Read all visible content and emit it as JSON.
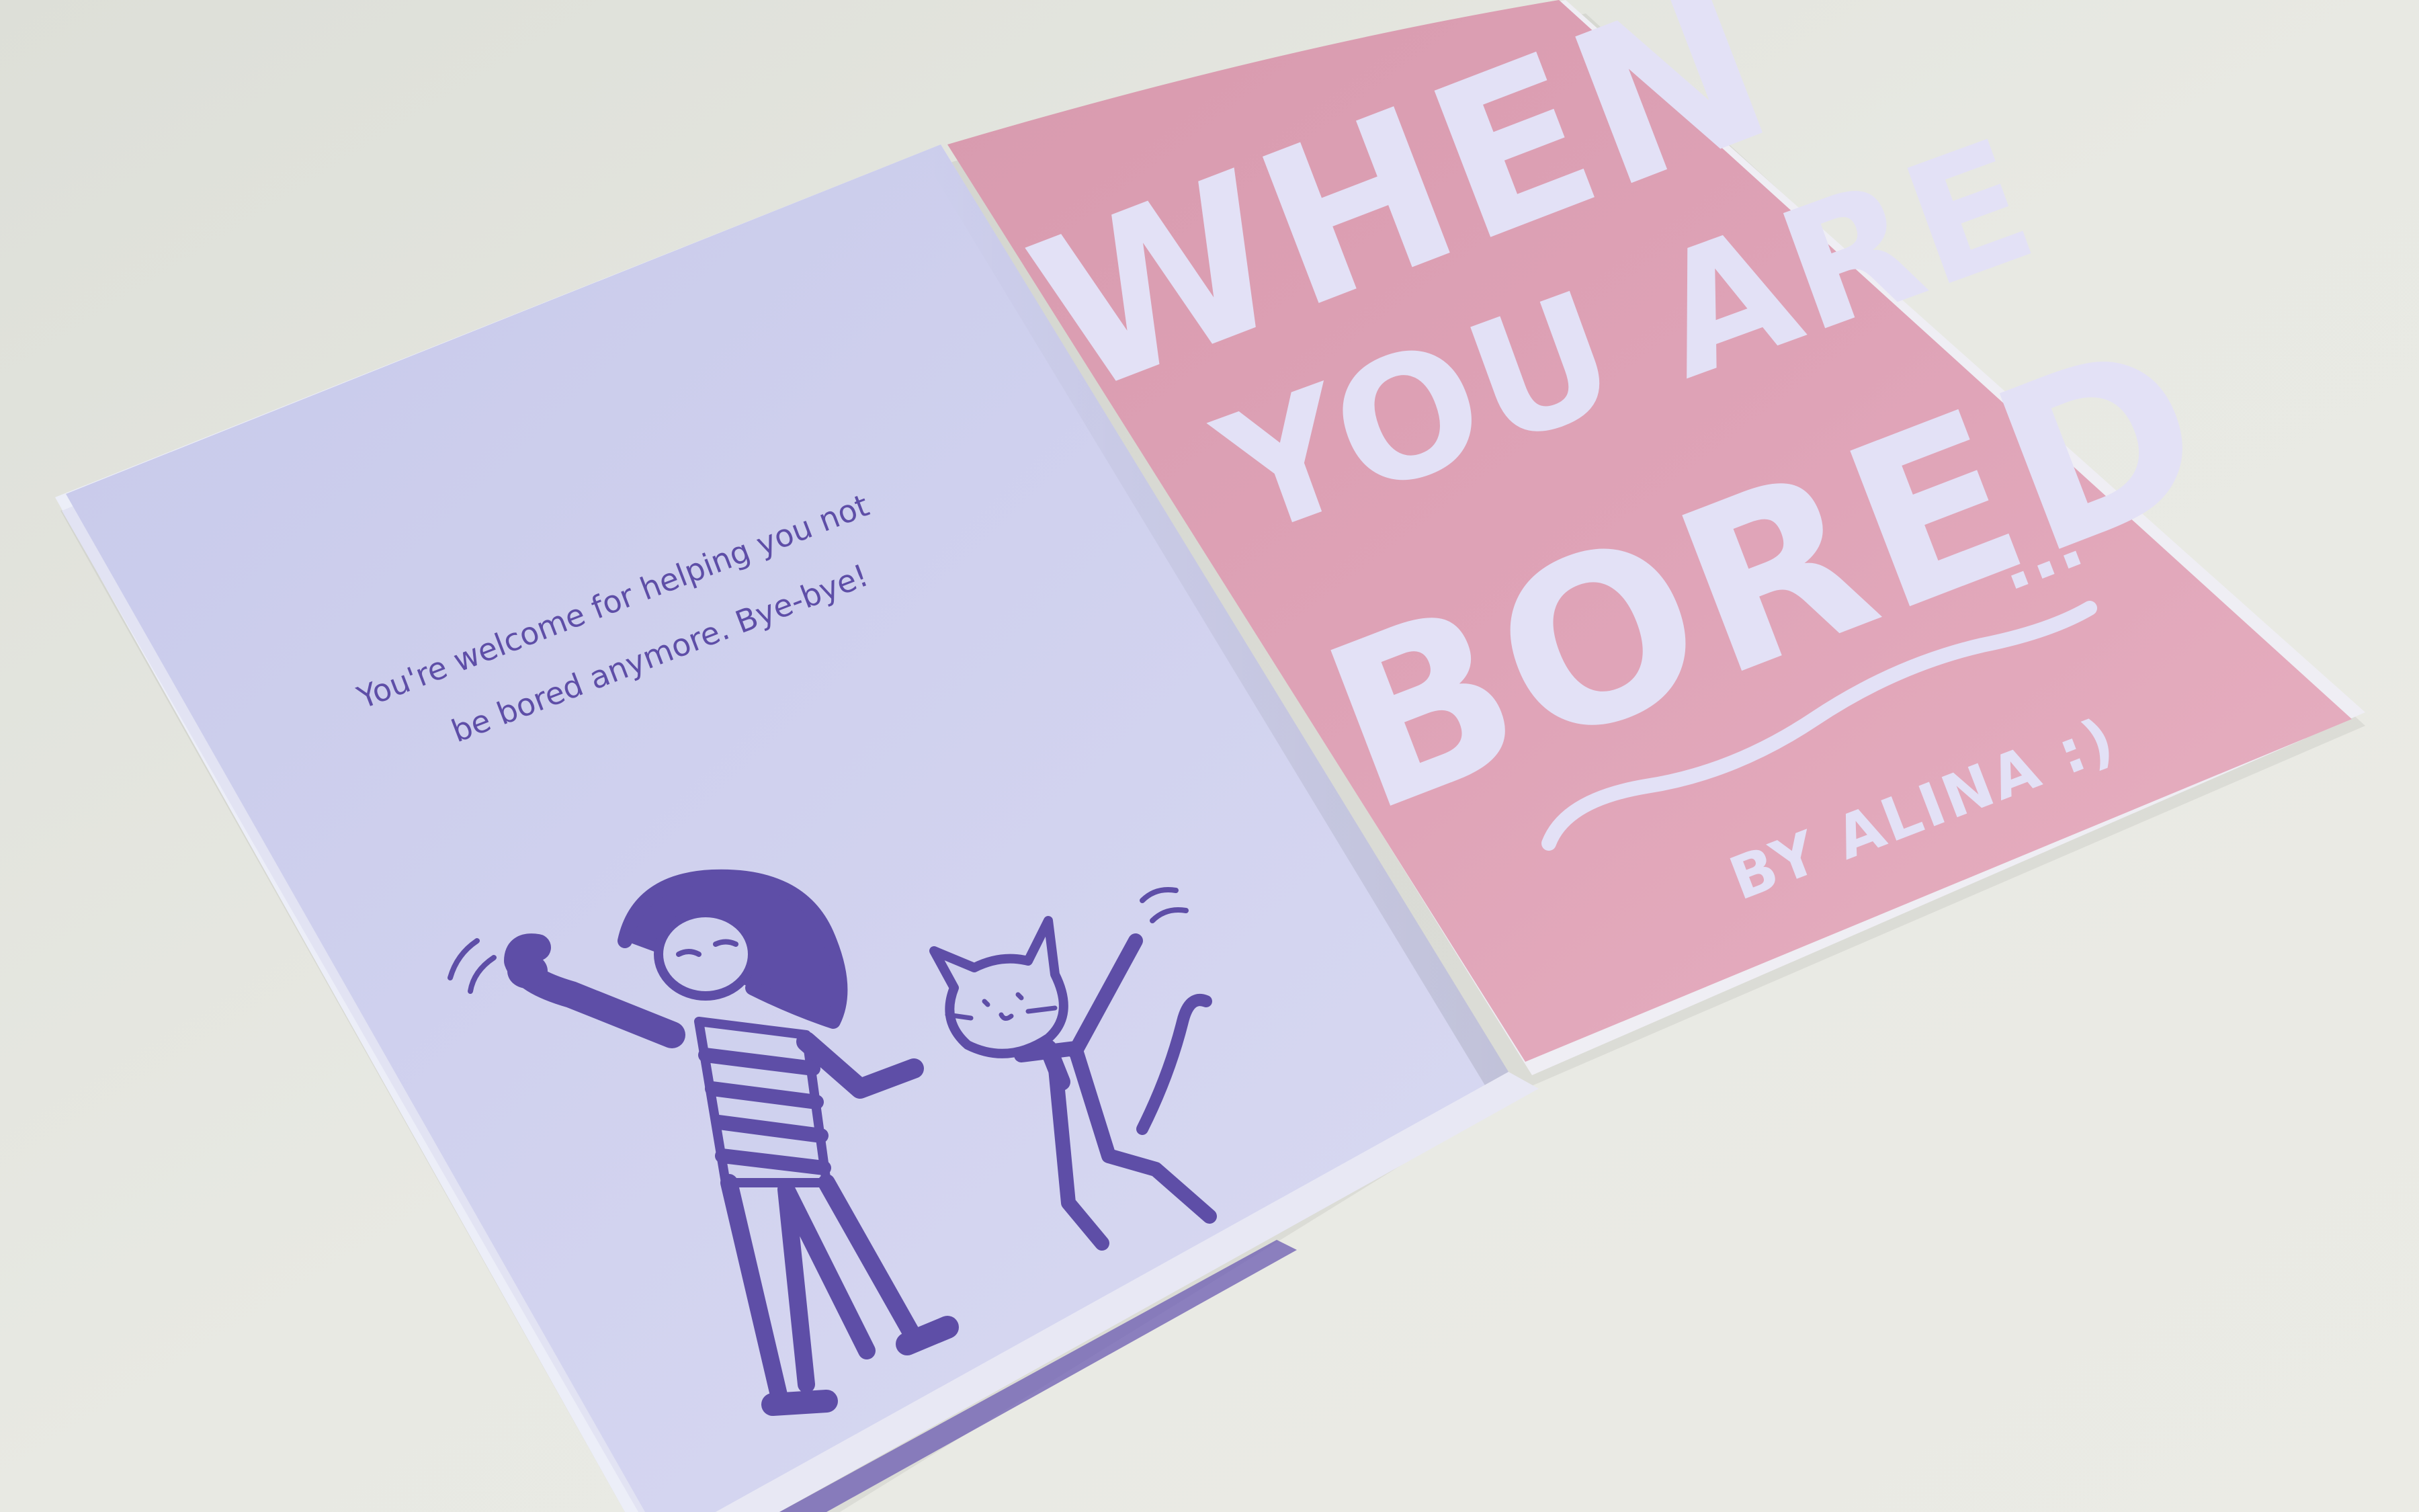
{
  "zine": {
    "left_page": {
      "message_line_1": "You're welcome for helping you not",
      "message_line_2": "be bored anymore. Bye-bye!",
      "illustration": "girl-and-cat-waving-icon"
    },
    "cover": {
      "title_line_1": "WHEN",
      "title_line_2": "YOU ARE",
      "title_line_3": "BORED",
      "ellipsis": "...",
      "byline": "BY ALINA :)"
    }
  },
  "colors": {
    "table": "#e6e7e1",
    "left_page": "#ced0ee",
    "cover_pink": "#dfa2b6",
    "cover_text": "#e3e1f6",
    "ink_purple": "#5e4ea7"
  }
}
